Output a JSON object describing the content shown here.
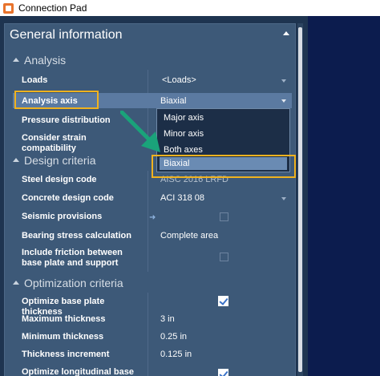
{
  "window": {
    "title": "Connection Pad"
  },
  "panel": {
    "header": "General information",
    "sections": {
      "analysis": "Analysis",
      "design": "Design criteria",
      "optimization": "Optimization criteria"
    },
    "analysis_props": {
      "loads_label": "Loads",
      "loads_value": "<Loads>",
      "axis_label": "Analysis axis",
      "axis_value": "Biaxial",
      "pressure_label": "Pressure distribution",
      "strain_label": "Consider strain compatibility"
    },
    "design_props": {
      "steel_label": "Steel design code",
      "steel_value": "AISC 2016 LRFD",
      "concrete_label": "Concrete design code",
      "concrete_value": "ACI 318 08",
      "seismic_label": "Seismic provisions",
      "bearing_label": "Bearing stress calculation",
      "bearing_value": "Complete area",
      "friction_label": "Include friction between base plate and support"
    },
    "optimization_props": {
      "optimize_thickness_label": "Optimize base plate thickness",
      "optimize_thickness_checked": true,
      "max_thickness_label": "Maximum thickness",
      "max_thickness_value": "3 in",
      "min_thickness_label": "Minimum thickness",
      "min_thickness_value": "0.25 in",
      "increment_label": "Thickness increment",
      "increment_value": "0.125 in",
      "optimize_longitudinal_label": "Optimize longitudinal base plate"
    }
  },
  "dropdown": {
    "options": [
      "Major axis",
      "Minor axis",
      "Both axes",
      "Biaxial"
    ],
    "highlighted": "Biaxial"
  },
  "colors": {
    "highlight_box": "#f0b21f",
    "callout_arrow": "#1aa37a",
    "panel_bg": "#3d5978",
    "selected_row": "#5b7aa1"
  }
}
